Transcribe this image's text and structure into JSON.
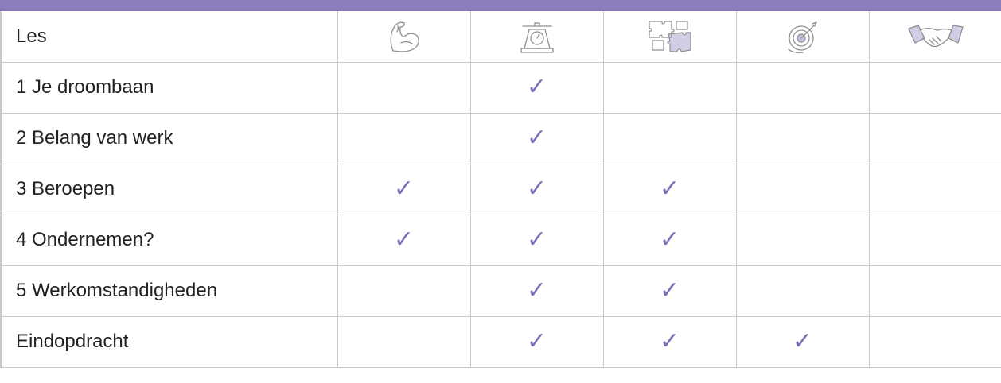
{
  "header": {
    "label": "Les",
    "columns": [
      {
        "icon": "flexed-arm-icon"
      },
      {
        "icon": "scale-icon"
      },
      {
        "icon": "puzzle-icon"
      },
      {
        "icon": "target-icon"
      },
      {
        "icon": "handshake-icon"
      }
    ]
  },
  "check_mark": "✓",
  "rows": [
    {
      "label": "1  Je droombaan",
      "checks": [
        false,
        true,
        false,
        false,
        false
      ]
    },
    {
      "label": "2 Belang van werk",
      "checks": [
        false,
        true,
        false,
        false,
        false
      ]
    },
    {
      "label": "3 Beroepen",
      "checks": [
        true,
        true,
        true,
        false,
        false
      ]
    },
    {
      "label": "4 Ondernemen?",
      "checks": [
        true,
        true,
        true,
        false,
        false
      ]
    },
    {
      "label": "5 Werkomstandigheden",
      "checks": [
        false,
        true,
        true,
        false,
        false
      ]
    },
    {
      "label": "Eindopdracht",
      "checks": [
        false,
        true,
        true,
        true,
        false
      ]
    }
  ],
  "colors": {
    "accent": "#8a7cbd",
    "check": "#7f6db5",
    "border": "#c9c9c9"
  }
}
